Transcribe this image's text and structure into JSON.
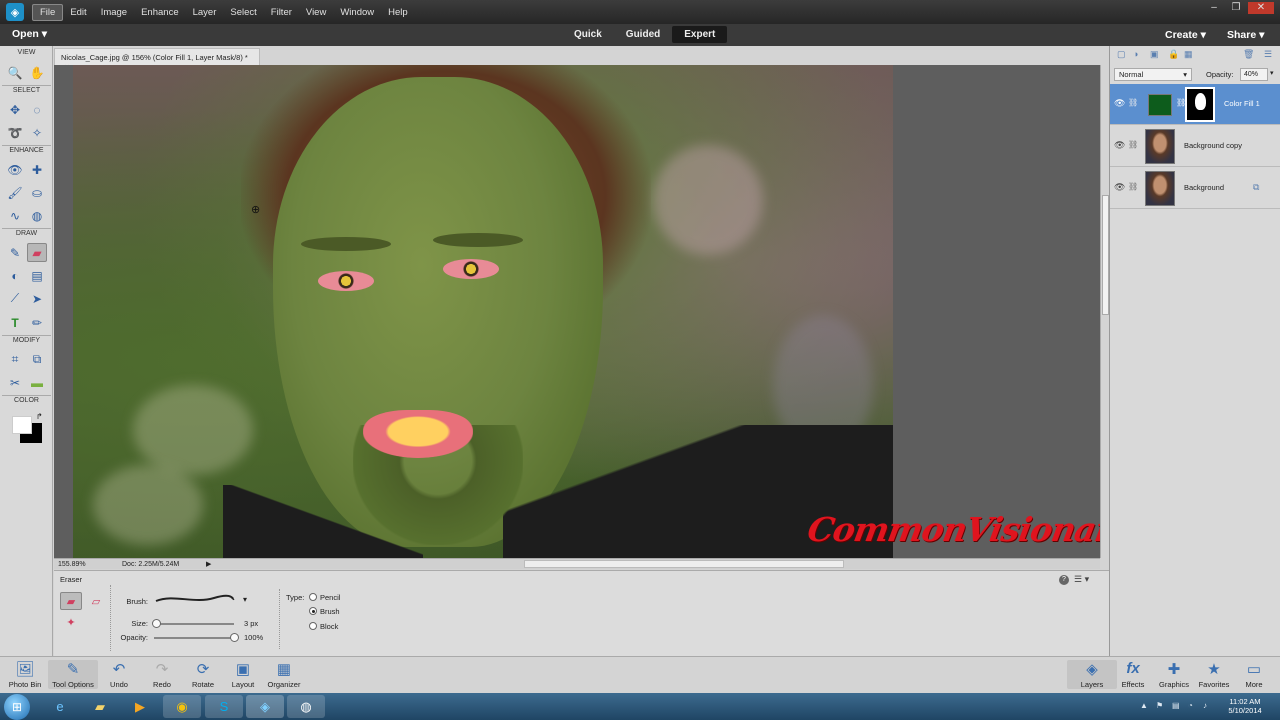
{
  "menubar": {
    "items": [
      "File",
      "Edit",
      "Image",
      "Enhance",
      "Layer",
      "Select",
      "Filter",
      "View",
      "Window",
      "Help"
    ],
    "active_index": 0
  },
  "modebar": {
    "open_label": "Open",
    "modes": [
      "Quick",
      "Guided",
      "Expert"
    ],
    "selected_mode": "Expert",
    "create_label": "Create",
    "share_label": "Share"
  },
  "toolbox": {
    "sections": {
      "view": "VIEW",
      "select": "SELECT",
      "enhance": "ENHANCE",
      "draw": "DRAW",
      "modify": "MODIFY",
      "color": "COLOR"
    }
  },
  "document": {
    "tab_title": "Nicolas_Cage.jpg @ 156% (Color Fill 1, Layer Mask/8) *",
    "tab_close": "×",
    "zoom": "155.89%",
    "doc_size": "Doc: 2.25M/5.24M"
  },
  "watermark": "CommonVisionary",
  "tool_options": {
    "title": "Eraser",
    "brush_label": "Brush:",
    "size_label": "Size:",
    "size_value": "3 px",
    "size_fraction": 0.03,
    "opacity_label": "Opacity:",
    "opacity_value": "100%",
    "opacity_fraction": 1.0,
    "type_label": "Type:",
    "types": [
      "Pencil",
      "Brush",
      "Block"
    ],
    "selected_type": "Brush"
  },
  "layers_panel": {
    "blend_mode": "Normal",
    "opacity_label": "Opacity:",
    "opacity_value": "40%",
    "layers": [
      {
        "name": "Color Fill 1",
        "selected": true
      },
      {
        "name": "Background copy",
        "selected": false
      },
      {
        "name": "Background",
        "selected": false
      }
    ]
  },
  "bottombar": {
    "left": [
      "Photo Bin",
      "Tool Options",
      "Undo",
      "Redo",
      "Rotate",
      "Layout",
      "Organizer"
    ],
    "right": [
      "Layers",
      "Effects",
      "Graphics",
      "Favorites",
      "More"
    ]
  },
  "taskbar": {
    "time": "11:02 AM",
    "date": "5/10/2014"
  },
  "colors": {
    "fill_layer": "#0d5c1c",
    "selected_layer": "#5b8fcf",
    "watermark": "#e0141e"
  }
}
